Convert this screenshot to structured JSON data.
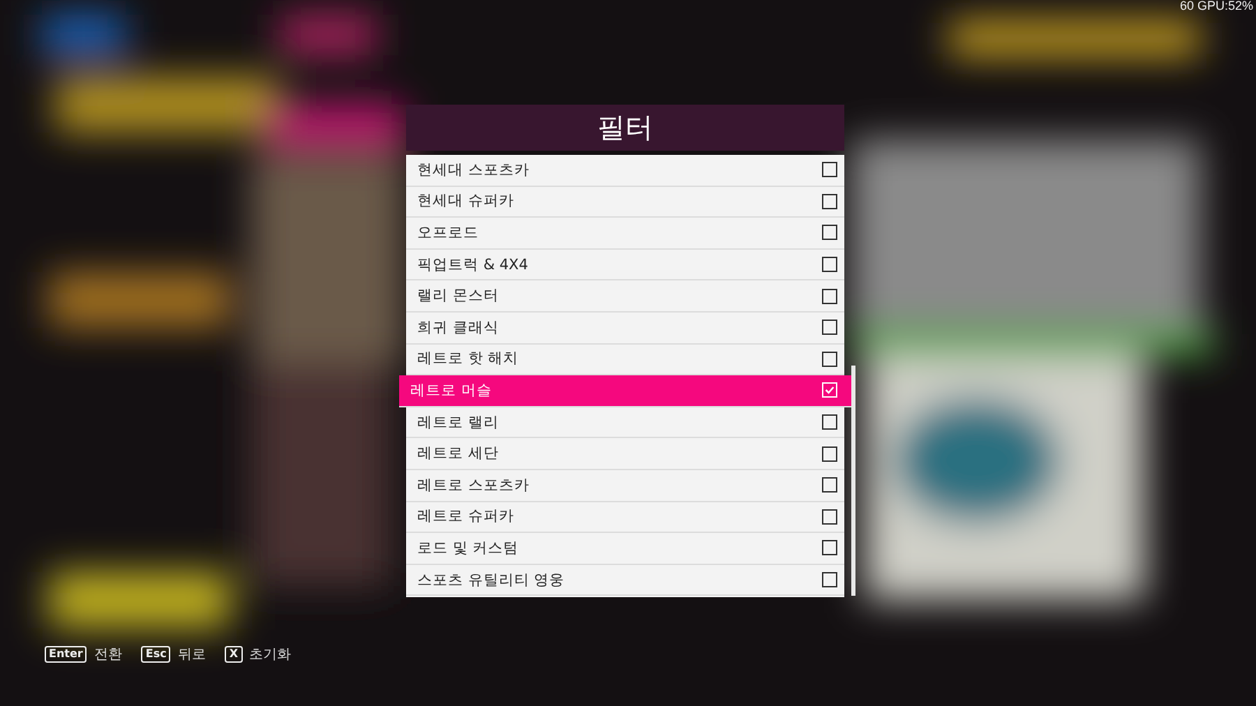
{
  "overlay": {
    "fps": "60 GPU:52%"
  },
  "dialog": {
    "title": "필터",
    "items": [
      {
        "label": "현세대 스포츠카",
        "checked": false,
        "selected": false
      },
      {
        "label": "현세대 슈퍼카",
        "checked": false,
        "selected": false
      },
      {
        "label": "오프로드",
        "checked": false,
        "selected": false
      },
      {
        "label": "픽업트럭 & 4X4",
        "checked": false,
        "selected": false
      },
      {
        "label": "랠리 몬스터",
        "checked": false,
        "selected": false
      },
      {
        "label": "희귀 클래식",
        "checked": false,
        "selected": false
      },
      {
        "label": "레트로 핫 해치",
        "checked": false,
        "selected": false
      },
      {
        "label": "레트로 머슬",
        "checked": true,
        "selected": true
      },
      {
        "label": "레트로 랠리",
        "checked": false,
        "selected": false
      },
      {
        "label": "레트로 세단",
        "checked": false,
        "selected": false
      },
      {
        "label": "레트로 스포츠카",
        "checked": false,
        "selected": false
      },
      {
        "label": "레트로 슈퍼카",
        "checked": false,
        "selected": false
      },
      {
        "label": "로드 및 커스텀",
        "checked": false,
        "selected": false
      },
      {
        "label": "스포츠 유틸리티 영웅",
        "checked": false,
        "selected": false
      }
    ]
  },
  "hints": [
    {
      "key": "Enter",
      "label": "전환"
    },
    {
      "key": "Esc",
      "label": "뒤로"
    },
    {
      "key": "X",
      "label": "초기화"
    }
  ]
}
